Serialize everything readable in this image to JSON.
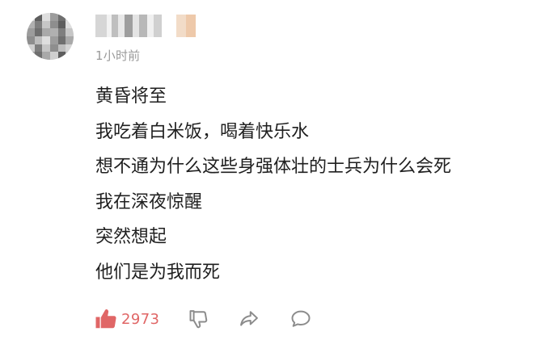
{
  "comment": {
    "time": "1小时前",
    "lines": [
      "黄昏将至",
      "我吃着白米饭，喝着快乐水",
      "想不通为什么这些身强体壮的士兵为什么会死",
      "我在深夜惊醒",
      "突然想起",
      "他们是为我而死"
    ],
    "like_count": "2973"
  },
  "icons": {
    "avatar": "avatar-blurred",
    "like": "thumbs-up-icon",
    "dislike": "thumbs-down-icon",
    "share": "share-arrow-icon",
    "reply": "speech-bubble-icon"
  },
  "colors": {
    "like_accent": "#e06666",
    "icon_gray": "#8c8c8c",
    "time_gray": "#9a9a9a",
    "text": "#1f1f1f"
  }
}
